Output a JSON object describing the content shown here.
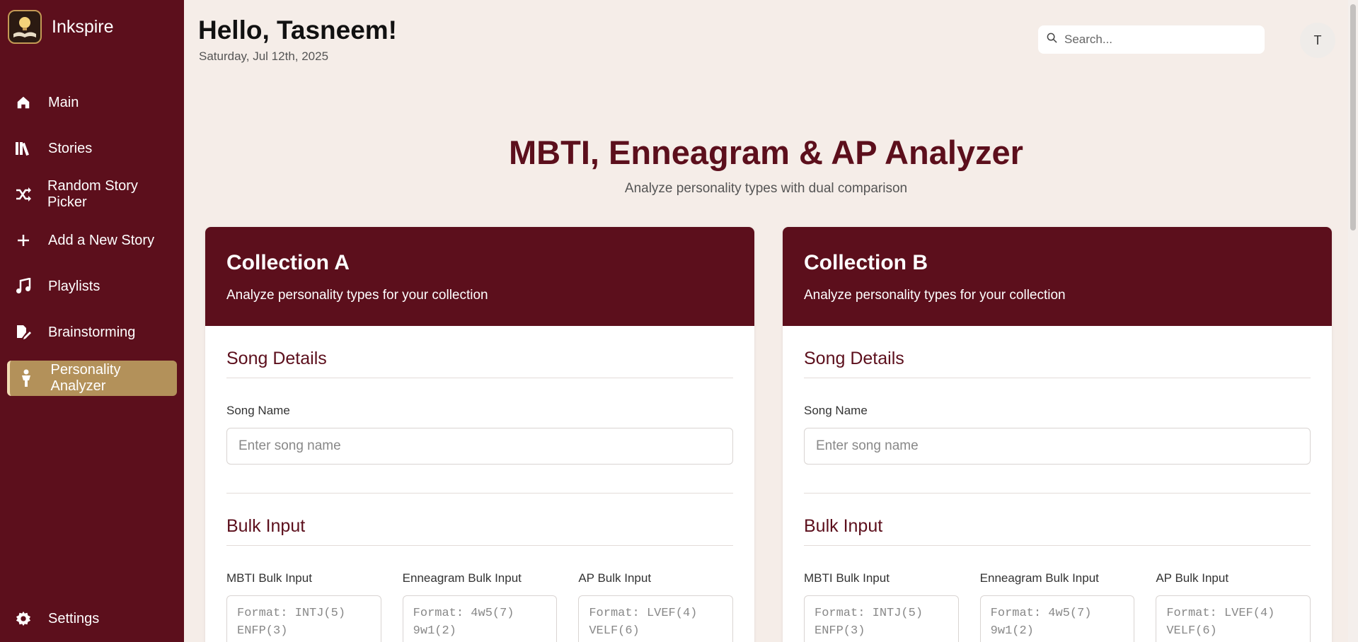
{
  "app": {
    "name": "Inkspire"
  },
  "sidebar": {
    "items": [
      {
        "label": "Main",
        "icon": "home-icon"
      },
      {
        "label": "Stories",
        "icon": "books-icon"
      },
      {
        "label": "Random Story Picker",
        "icon": "shuffle-icon"
      },
      {
        "label": "Add a New Story",
        "icon": "plus-icon"
      },
      {
        "label": "Playlists",
        "icon": "music-icon"
      },
      {
        "label": "Brainstorming",
        "icon": "file-pen-icon"
      },
      {
        "label": "Personality Analyzer",
        "icon": "person-icon",
        "active": true
      }
    ],
    "settings": {
      "label": "Settings",
      "icon": "gear-icon"
    }
  },
  "header": {
    "greeting": "Hello, Tasneem!",
    "date": "Saturday, Jul 12th, 2025",
    "search_placeholder": "Search...",
    "avatar_initial": "T"
  },
  "main": {
    "title": "MBTI, Enneagram & AP Analyzer",
    "subtitle": "Analyze personality types with dual comparison",
    "collections": [
      {
        "title": "Collection A",
        "description": "Analyze personality types for your collection",
        "song_section": "Song Details",
        "song_label": "Song Name",
        "song_placeholder": "Enter song name",
        "bulk_section": "Bulk Input",
        "bulk": [
          {
            "label": "MBTI Bulk Input",
            "placeholder": "Format: INTJ(5)\nENFP(3)"
          },
          {
            "label": "Enneagram Bulk Input",
            "placeholder": "Format: 4w5(7)\n9w1(2)"
          },
          {
            "label": "AP Bulk Input",
            "placeholder": "Format: LVEF(4)\nVELF(6)"
          }
        ]
      },
      {
        "title": "Collection B",
        "description": "Analyze personality types for your collection",
        "song_section": "Song Details",
        "song_label": "Song Name",
        "song_placeholder": "Enter song name",
        "bulk_section": "Bulk Input",
        "bulk": [
          {
            "label": "MBTI Bulk Input",
            "placeholder": "Format: INTJ(5)\nENFP(3)"
          },
          {
            "label": "Enneagram Bulk Input",
            "placeholder": "Format: 4w5(7)\n9w1(2)"
          },
          {
            "label": "AP Bulk Input",
            "placeholder": "Format: LVEF(4)\nVELF(6)"
          }
        ]
      }
    ]
  },
  "colors": {
    "brand": "#5c0f1c",
    "active": "#b3915a",
    "background": "#f5ede8"
  }
}
